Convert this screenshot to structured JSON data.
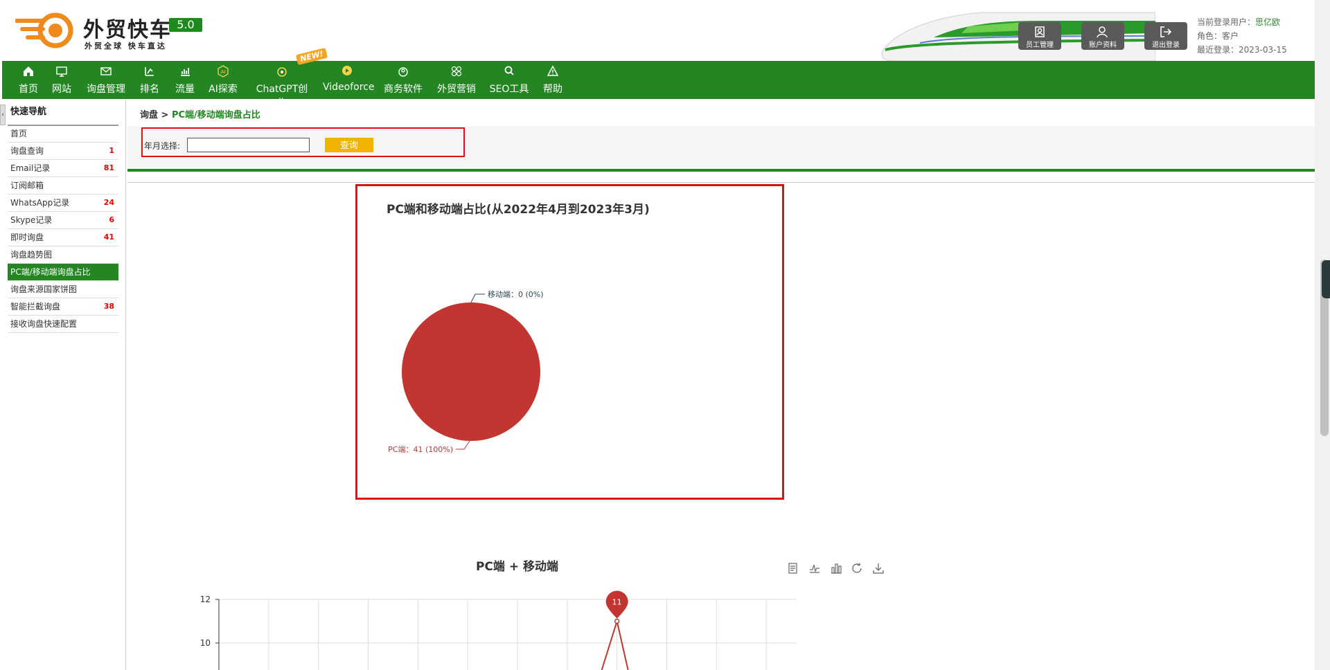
{
  "header": {
    "brand": "外贸快车",
    "slogan": "外贸全球 快车直达",
    "version": "5.0",
    "buttons": [
      {
        "label": "员工管理",
        "icon": "staff-icon"
      },
      {
        "label": "账户资料",
        "icon": "user-profile-icon"
      },
      {
        "label": "退出登录",
        "icon": "logout-icon"
      }
    ],
    "user_label": "当前登录用户：",
    "user_name": "思亿欧",
    "role_label": "角色：",
    "role": "客户",
    "last_login_label": "最近登录：",
    "last_login": "2023-03-15"
  },
  "nav": {
    "items": [
      {
        "label": "首页",
        "icon": "home-icon"
      },
      {
        "label": "网站",
        "icon": "website-icon"
      },
      {
        "label": "询盘管理",
        "icon": "mail-icon"
      },
      {
        "label": "排名",
        "icon": "ranking-icon"
      },
      {
        "label": "流量",
        "icon": "traffic-icon"
      },
      {
        "label": "AI探索",
        "icon": "ai-icon"
      },
      {
        "label": "ChatGPT创作",
        "icon": "chatgpt-icon"
      },
      {
        "label": "Videoforce",
        "icon": "video-icon"
      },
      {
        "label": "商务软件",
        "icon": "software-icon"
      },
      {
        "label": "外贸营销",
        "icon": "marketing-icon"
      },
      {
        "label": "SEO工具",
        "icon": "search-icon"
      },
      {
        "label": "帮助",
        "icon": "warning-icon"
      }
    ],
    "new_badge": "NEW!"
  },
  "sidebar": {
    "title": "快速导航",
    "items": [
      {
        "label": "首页",
        "count": ""
      },
      {
        "label": "询盘查询",
        "count": "1"
      },
      {
        "label": "Email记录",
        "count": "81"
      },
      {
        "label": "订阅邮箱",
        "count": ""
      },
      {
        "label": "WhatsApp记录",
        "count": "24"
      },
      {
        "label": "Skype记录",
        "count": "6"
      },
      {
        "label": "即时询盘",
        "count": "41"
      },
      {
        "label": "询盘趋势图",
        "count": ""
      },
      {
        "label": "PC端/移动端询盘占比",
        "count": ""
      },
      {
        "label": "询盘来源国家饼图",
        "count": ""
      },
      {
        "label": "智能拦截询盘",
        "count": "38"
      },
      {
        "label": "接收询盘快速配置",
        "count": ""
      }
    ]
  },
  "breadcrumb": {
    "root": "询盘",
    "sep": " > ",
    "current": "PC端/移动端询盘占比"
  },
  "filter": {
    "label": "年月选择:",
    "value": "",
    "button": "查询"
  },
  "chart_data": [
    {
      "type": "pie",
      "title": "PC端和移动端占比(从2022年4月到2023年3月)",
      "slices": [
        {
          "name": "PC端",
          "value": 41,
          "percent": "100%",
          "label": "PC端：41 (100%)",
          "color": "#c23531"
        },
        {
          "name": "移动端",
          "value": 0,
          "percent": "0%",
          "label": "移动端：0 (0%)",
          "color": "#2f4554"
        }
      ]
    },
    {
      "type": "line",
      "title": "PC端 + 移动端",
      "y_ticks": [
        12,
        10
      ],
      "ylim": [
        0,
        12
      ],
      "x_count": 12,
      "peak": {
        "index": 8,
        "value": 11
      },
      "marker_label": "11",
      "color": "#c23531"
    }
  ],
  "toolbox": [
    "data-view-icon",
    "line-chart-icon",
    "bar-chart-icon",
    "restore-icon",
    "download-icon"
  ]
}
